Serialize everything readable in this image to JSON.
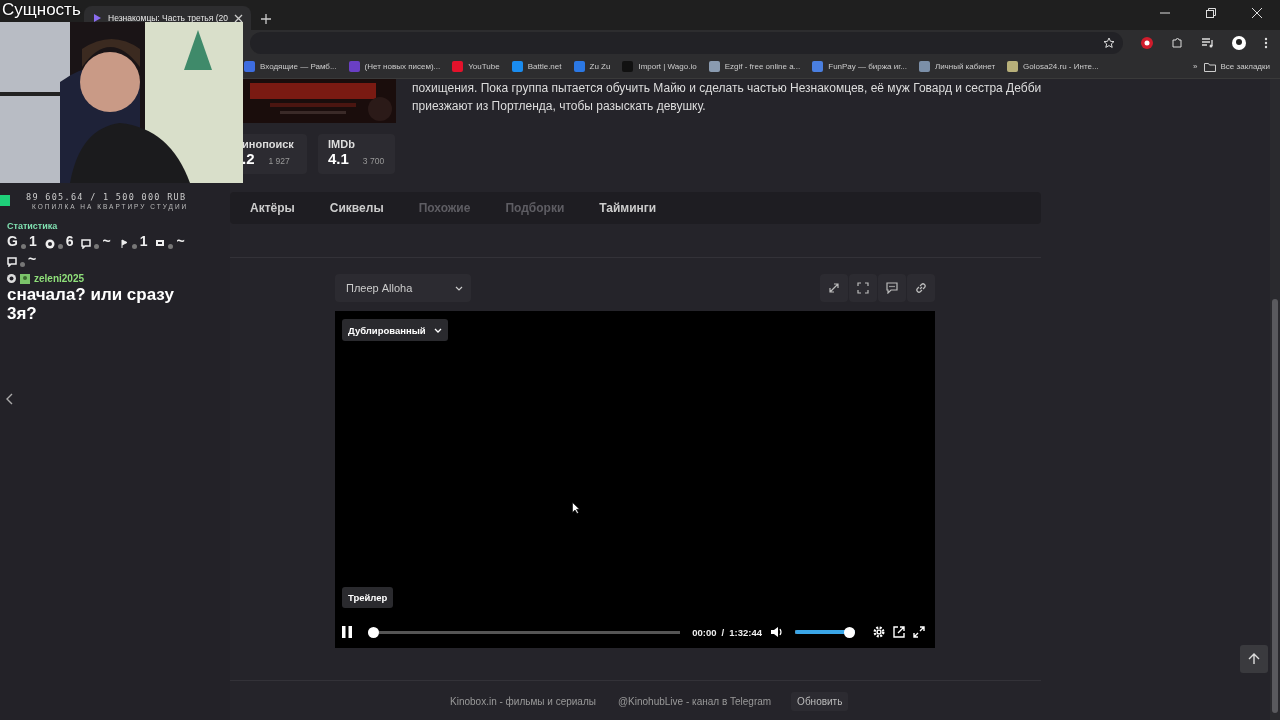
{
  "overlay_title": "Сущность",
  "browser": {
    "tabs": [
      {
        "title": "Незнакомцы: Часть третья (20",
        "selected": true
      }
    ],
    "bookmarks": [
      {
        "label": "Входящие — Рамб...",
        "color": "#3d6de0"
      },
      {
        "label": "(Нет новых писем)...",
        "color": "#6a3fc4"
      },
      {
        "label": "YouTube",
        "color": "#e3122b"
      },
      {
        "label": "Battle.net",
        "color": "#1a8cf0"
      },
      {
        "label": "Zu Zu",
        "color": "#2b78e4"
      },
      {
        "label": "Import | Wago.io",
        "color": "#111111"
      },
      {
        "label": "Ezgif - free online a...",
        "color": "#8a9bb0"
      },
      {
        "label": "FunPay — биржа иг...",
        "color": "#4a7fe0"
      },
      {
        "label": "Личный кабинет",
        "color": "#7b8fa8"
      },
      {
        "label": "Golosa24.ru - Инте...",
        "color": "#b8b07a"
      }
    ],
    "more": "»",
    "all_bookmarks": "Все закладки"
  },
  "stream": {
    "donation": {
      "amount": "89 605.64 / 1 500 000 RUB",
      "goal": "КОПИЛКА НА КВАРТИРУ СТУДИИ",
      "color": "#1fd07a"
    },
    "stats_title": "Статистика",
    "stats": [
      {
        "kind": "letter",
        "label": "G",
        "value": "1"
      },
      {
        "kind": "circle",
        "value": "6"
      },
      {
        "kind": "bubble",
        "value": "~"
      },
      {
        "kind": "flag",
        "value": "1"
      },
      {
        "kind": "screen",
        "value": "~"
      },
      {
        "kind": "bubble",
        "value": "~"
      }
    ],
    "message": {
      "user": "zeleni2025",
      "text": "сначала? или сразу 3я?"
    }
  },
  "movie": {
    "description": "похищения. Пока группа пытается обучить Майю и сделать частью Незнакомцев, её муж Говард и сестра Дебби приезжают из Портленда, чтобы разыскать девушку.",
    "ratings": [
      {
        "source": "инопоиск",
        "score": ".2",
        "votes": "1 927"
      },
      {
        "source": "IMDb",
        "score": "4.1",
        "votes": "3 700"
      }
    ],
    "tabs": [
      {
        "label": "Актёры",
        "disabled": false
      },
      {
        "label": "Сиквелы",
        "disabled": false
      },
      {
        "label": "Похожие",
        "disabled": true
      },
      {
        "label": "Подборки",
        "disabled": true
      },
      {
        "label": "Тайминги",
        "disabled": false
      }
    ],
    "player": {
      "source_select": "Плеер Alloha",
      "voice_select": "Дублированный",
      "badge": "Трейлер",
      "playing": true,
      "progress": {
        "level": 0
      },
      "current_time": "00:00",
      "separator": "/",
      "duration": "1:32:44",
      "volume": {
        "level": 1
      }
    },
    "footer": {
      "links": [
        "Kinobox.in - фильмы и сериалы",
        "@KinohubLive - канал в Telegram"
      ],
      "button": "Обновить"
    }
  }
}
